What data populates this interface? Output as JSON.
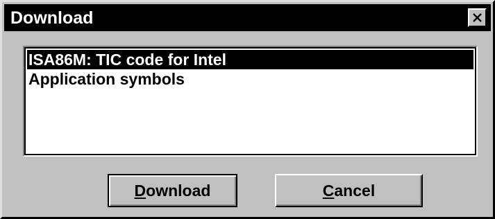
{
  "window": {
    "title": "Download",
    "close_icon": "close-icon"
  },
  "list": {
    "items": [
      {
        "label": "ISA86M: TIC code for Intel",
        "selected": true
      },
      {
        "label": "Application symbols",
        "selected": false
      }
    ]
  },
  "buttons": {
    "download": {
      "mnemonic": "D",
      "rest": "ownload"
    },
    "cancel": {
      "mnemonic": "C",
      "rest": "ancel"
    }
  },
  "colors": {
    "face": "#c0c0c0",
    "titlebar": "#000000",
    "selection": "#000000",
    "list_background": "#ffffff"
  }
}
